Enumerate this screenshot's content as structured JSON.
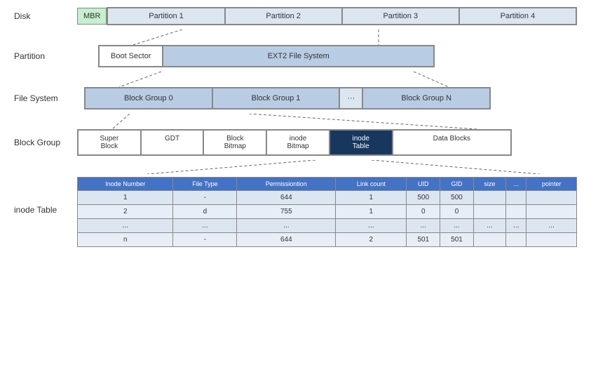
{
  "diagram": {
    "disk": {
      "label": "Disk",
      "mbr": "MBR",
      "partitions": [
        "Partition 1",
        "Partition 2",
        "Partition 3",
        "Partition 4"
      ]
    },
    "partition": {
      "label": "Partition",
      "boot": "Boot Sector",
      "ext2": "EXT2 File System"
    },
    "filesystem": {
      "label": "File System",
      "groups": [
        "Block Group 0",
        "Block Group 1",
        "···",
        "Block Group N"
      ]
    },
    "blockgroup": {
      "label": "Block Group",
      "items": [
        "Super\nBlock",
        "GDT",
        "Block\nBitmap",
        "inode\nBitmap",
        "inode\nTable",
        "Data Blocks"
      ]
    },
    "inodetable": {
      "label": "inode Table",
      "headers": [
        "Inode Number",
        "File Type",
        "Permissiontion",
        "Link count",
        "UID",
        "GID",
        "size",
        "...",
        "pointer"
      ],
      "rows": [
        [
          "1",
          "-",
          "644",
          "1",
          "500",
          "500",
          "",
          "",
          ""
        ],
        [
          "2",
          "d",
          "755",
          "1",
          "0",
          "0",
          "",
          "",
          ""
        ],
        [
          "...",
          "...",
          "...",
          "...",
          "...",
          "...",
          "...",
          "...",
          "..."
        ],
        [
          "n",
          "-",
          "644",
          "2",
          "501",
          "501",
          "",
          "",
          ""
        ]
      ]
    }
  }
}
